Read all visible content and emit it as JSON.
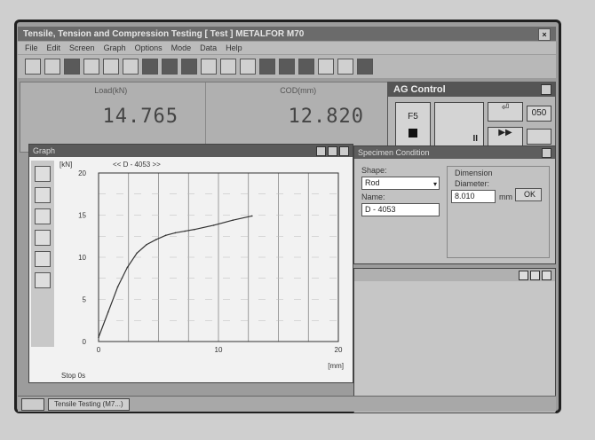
{
  "app": {
    "title": "Tensile, Tension and Compression Testing   [ Test ]   METALFOR M70",
    "close_glyph": "×"
  },
  "menu": [
    "File",
    "Edit",
    "Screen",
    "Graph",
    "Options",
    "Mode",
    "Data",
    "Help"
  ],
  "readouts": [
    {
      "label": "Load(kN)",
      "value": "14.765"
    },
    {
      "label": "COD(mm)",
      "value": "12.820"
    }
  ],
  "ag_control": {
    "title": "AG Control",
    "f5_label": "F5",
    "return_glyph": "⏎",
    "ffwd_glyph": "▶▶",
    "small_value": "050",
    "pause_glyph": "II"
  },
  "graph": {
    "title": "Graph",
    "y_axis_unit": "[kN]",
    "series_label": "<< D - 4053 >>",
    "y_ticks": [
      "20",
      "15",
      "10",
      "5",
      "0"
    ],
    "x_ticks": [
      "0",
      "10",
      "20"
    ],
    "x_axis_unit": "[mm]",
    "status_text": "Stop   0s",
    "chart_data": {
      "type": "line",
      "series": [
        {
          "name": "D - 4053",
          "x": [
            0,
            0.8,
            1.6,
            2.4,
            3.2,
            4.0,
            4.8,
            5.6,
            6.4,
            7.2,
            8.0,
            9.6,
            11.2,
            12.8
          ],
          "y": [
            0.5,
            3.5,
            6.5,
            8.8,
            10.5,
            11.5,
            12.1,
            12.6,
            12.9,
            13.1,
            13.3,
            13.8,
            14.4,
            14.9
          ]
        }
      ],
      "xlim": [
        0,
        20
      ],
      "ylim": [
        0,
        20
      ],
      "grid": true
    }
  },
  "specimen": {
    "title": "Specimen Condition",
    "shape_label": "Shape:",
    "shape_value": "Rod",
    "name_label": "Name:",
    "name_value": "D - 4053",
    "dimension_label": "Dimension",
    "diameter_label": "Diameter:",
    "diameter_value": "8.010",
    "diameter_unit": "mm",
    "ok_label": "OK"
  },
  "taskbar": {
    "item": "Tensile Testing (M7...)"
  }
}
